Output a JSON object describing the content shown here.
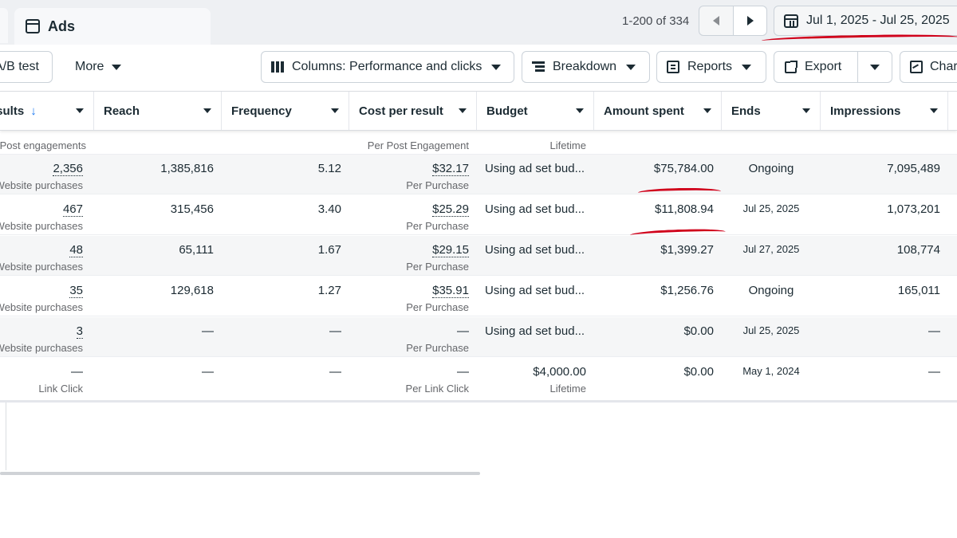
{
  "header": {
    "tab_label": "Ads",
    "pager_text": "1-200 of 334",
    "date_range": "Jul 1, 2025 - Jul 25, 2025"
  },
  "toolbar": {
    "ab_test_label": "A/B test",
    "more_label": "More",
    "columns_label": "Columns: Performance and clicks",
    "breakdown_label": "Breakdown",
    "reports_label": "Reports",
    "export_label": "Export",
    "charts_label": "Charts"
  },
  "table": {
    "columns": [
      "Results",
      "Reach",
      "Frequency",
      "Cost per result",
      "Budget",
      "Amount spent",
      "Ends",
      "Impressions"
    ],
    "partial_row": {
      "results_sub": "Post engagements",
      "cost_sub": "Per Post Engagement",
      "budget_sub": "Lifetime"
    },
    "rows": [
      {
        "results": "2,356",
        "results_sub": "Website purchases",
        "reach": "1,385,816",
        "frequency": "5.12",
        "cost": "$32.17",
        "cost_sub": "Per Purchase",
        "budget": "Using ad set bud...",
        "budget_sub": "",
        "spent": "$75,784.00",
        "ends": "Ongoing",
        "impressions": "7,095,489"
      },
      {
        "results": "467",
        "results_sub": "Website purchases",
        "reach": "315,456",
        "frequency": "3.40",
        "cost": "$25.29",
        "cost_sub": "Per Purchase",
        "budget": "Using ad set bud...",
        "budget_sub": "",
        "spent": "$11,808.94",
        "ends": "Jul 25, 2025",
        "impressions": "1,073,201"
      },
      {
        "results": "48",
        "results_sub": "Website purchases",
        "reach": "65,111",
        "frequency": "1.67",
        "cost": "$29.15",
        "cost_sub": "Per Purchase",
        "budget": "Using ad set bud...",
        "budget_sub": "",
        "spent": "$1,399.27",
        "ends": "Jul 27, 2025",
        "impressions": "108,774"
      },
      {
        "results": "35",
        "results_sub": "Website purchases",
        "reach": "129,618",
        "frequency": "1.27",
        "cost": "$35.91",
        "cost_sub": "Per Purchase",
        "budget": "Using ad set bud...",
        "budget_sub": "",
        "spent": "$1,256.76",
        "ends": "Ongoing",
        "impressions": "165,011"
      },
      {
        "results": "3",
        "results_sub": "Website purchases",
        "reach": "—",
        "frequency": "—",
        "cost": "—",
        "cost_sub": "Per Purchase",
        "budget": "Using ad set bud...",
        "budget_sub": "",
        "spent": "$0.00",
        "ends": "Jul 25, 2025",
        "impressions": "—"
      },
      {
        "results": "—",
        "results_sub": "Link Click",
        "reach": "—",
        "frequency": "—",
        "cost": "—",
        "cost_sub": "Per Link Click",
        "budget": "$4,000.00",
        "budget_sub": "Lifetime",
        "spent": "$0.00",
        "ends": "May 1, 2024",
        "impressions": "—"
      }
    ]
  },
  "colors": {
    "accent": "#1877f2",
    "annotation": "#d0021b",
    "alt_row": "#f5f6f7"
  }
}
